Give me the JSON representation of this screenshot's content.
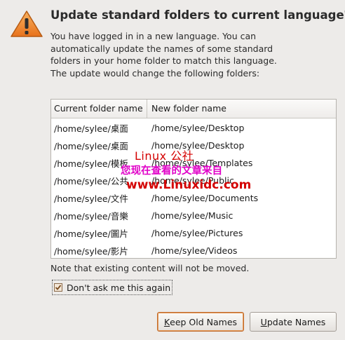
{
  "dialog": {
    "title": "Update standard folders to current language?",
    "message": "You have logged in in a new language. You can automatically update the names of some standard folders in your home folder to match this language. The update would change the following folders:",
    "icon": "warning-icon",
    "accent": "#f08c2e"
  },
  "table": {
    "headers": [
      "Current folder name",
      "New folder name"
    ],
    "rows": [
      {
        "current": "/home/sylee/桌面",
        "new": "/home/sylee/Desktop"
      },
      {
        "current": "/home/sylee/桌面",
        "new": "/home/sylee/Desktop"
      },
      {
        "current": "/home/sylee/模板",
        "new": "/home/sylee/Templates"
      },
      {
        "current": "/home/sylee/公共",
        "new": "/home/sylee/Public"
      },
      {
        "current": "/home/sylee/文件",
        "new": "/home/sylee/Documents"
      },
      {
        "current": "/home/sylee/音樂",
        "new": "/home/sylee/Music"
      },
      {
        "current": "/home/sylee/圖片",
        "new": "/home/sylee/Pictures"
      },
      {
        "current": "/home/sylee/影片",
        "new": "/home/sylee/Videos"
      }
    ]
  },
  "note": "Note that existing content will not be moved.",
  "checkbox": {
    "label": "Don't ask me this again",
    "checked": true
  },
  "buttons": {
    "keep": {
      "prefix": "",
      "underline": "K",
      "rest": "eep Old Names"
    },
    "update": {
      "prefix": "",
      "underline": "U",
      "rest": "pdate Names"
    }
  },
  "watermark": {
    "line1": "Linux 公社",
    "line2": "您现在查看的文章来自",
    "line3": "www.Linuxidc.com"
  }
}
